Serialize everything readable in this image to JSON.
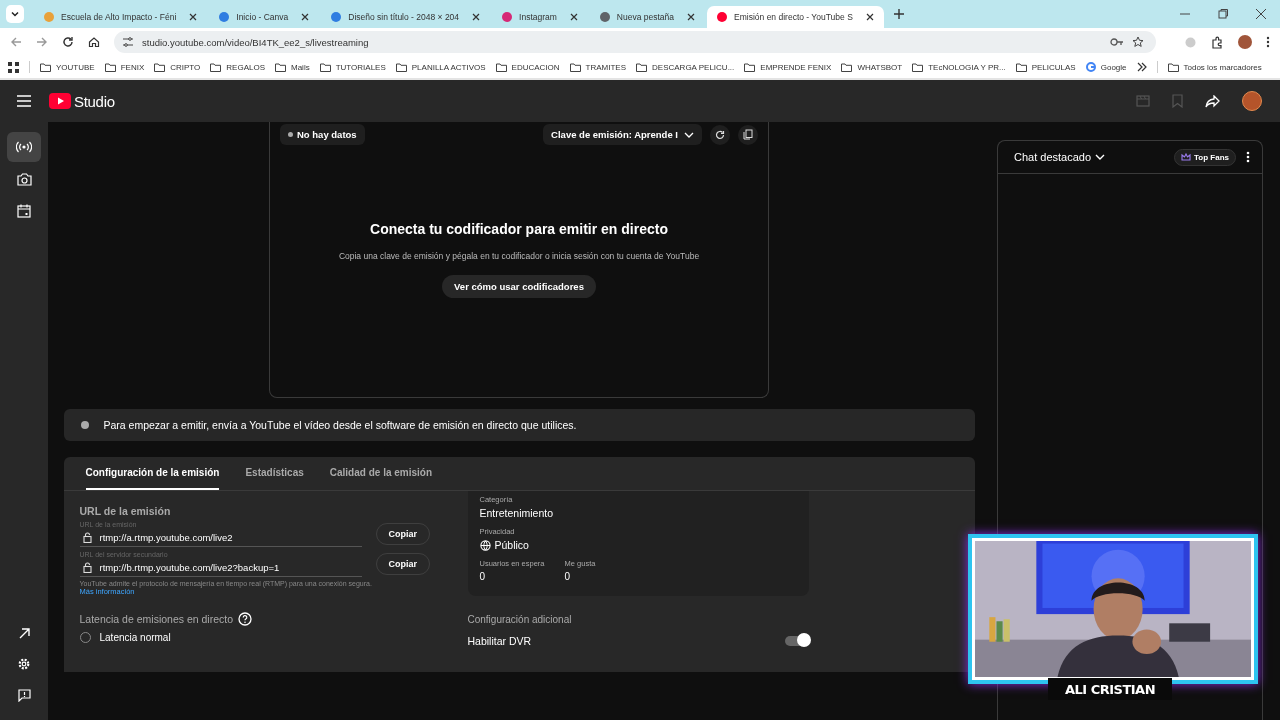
{
  "browser": {
    "tabs": [
      {
        "title": "Escuela de Alto Impacto - Féni",
        "kind": "fenix",
        "selected": false
      },
      {
        "title": "Inicio - Canva",
        "kind": "canva",
        "selected": false
      },
      {
        "title": "Diseño sin título - 2048 × 204",
        "kind": "canva",
        "selected": false
      },
      {
        "title": "Instagram",
        "kind": "instagram",
        "selected": false
      },
      {
        "title": "Nueva pestaña",
        "kind": "chrome",
        "selected": false
      },
      {
        "title": "Emisión en directo - YouTube S",
        "kind": "youtube",
        "selected": true
      }
    ],
    "address": "studio.youtube.com/video/BI4TK_ee2_s/livestreaming",
    "bookmarks": [
      {
        "label": "YOUTUBE",
        "kind": "folder"
      },
      {
        "label": "FENIX",
        "kind": "folder"
      },
      {
        "label": "CRIPTO",
        "kind": "folder"
      },
      {
        "label": "REGALOS",
        "kind": "folder"
      },
      {
        "label": "Mails",
        "kind": "folder"
      },
      {
        "label": "TUTORIALES",
        "kind": "folder"
      },
      {
        "label": "PLANILLA ACTIVOS",
        "kind": "folder"
      },
      {
        "label": "EDUCACION",
        "kind": "folder"
      },
      {
        "label": "TRAMITES",
        "kind": "folder"
      },
      {
        "label": "DESCARGA PELICU...",
        "kind": "folder"
      },
      {
        "label": "EMPRENDE FENIX",
        "kind": "folder"
      },
      {
        "label": "WHATSBOT",
        "kind": "folder"
      },
      {
        "label": "TEcNOLOGIA Y PR...",
        "kind": "folder"
      },
      {
        "label": "PELICULAS",
        "kind": "folder"
      },
      {
        "label": "Google",
        "kind": "google"
      }
    ],
    "all_bookmarks": "Todos los marcadores"
  },
  "studio": {
    "logo": "Studio",
    "rail": [
      {
        "selected": true
      },
      {
        "selected": false
      },
      {
        "selected": false
      }
    ]
  },
  "preview": {
    "status": "No hay datos",
    "stream_key": "Clave de emisión: Aprende I",
    "heading": "Conecta tu codificador para emitir en directo",
    "subtitle": "Copia una clave de emisión y pégala en tu codificador o inicia sesión con tu cuenta de YouTube",
    "button": "Ver cómo usar codificadores"
  },
  "info_bar": "Para empezar a emitir, envía a YouTube el vídeo desde el software de emisión en directo que utilices.",
  "settings": {
    "tabs": [
      {
        "label": "Configuración de la emisión",
        "selected": true
      },
      {
        "label": "Estadísticas",
        "selected": false
      },
      {
        "label": "Calidad de la emisión",
        "selected": false
      }
    ],
    "url_title": "URL de la emisión",
    "fields": [
      {
        "label": "URL de la emisión",
        "value": "rtmp://a.rtmp.youtube.com/live2",
        "button": "Copiar"
      },
      {
        "label": "URL del servidor secundario",
        "value": "rtmp://b.rtmp.youtube.com/live2?backup=1",
        "button": "Copiar"
      }
    ],
    "note": "YouTube admite el protocolo de mensajería en tiempo real (RTMP) para una conexión segura.",
    "link": "Más información",
    "latency_title": "Latencia de emisiones en directo",
    "latency_options": [
      {
        "label": "Latencia normal",
        "selected": false
      }
    ],
    "category_label": "Categoría",
    "category": "Entretenimiento",
    "privacy_label": "Privacidad",
    "privacy": "Público",
    "stats": [
      {
        "label": "Usuarios en espera",
        "value": "0"
      },
      {
        "label": "Me gusta",
        "value": "0"
      }
    ],
    "additional_title": "Configuración adicional",
    "toggles": [
      {
        "label": "Habilitar DVR",
        "on": true
      }
    ]
  },
  "chat": {
    "title": "Chat destacado",
    "badge": "Top Fans"
  },
  "webcam": {
    "name": "ALI CRISTIAN"
  }
}
